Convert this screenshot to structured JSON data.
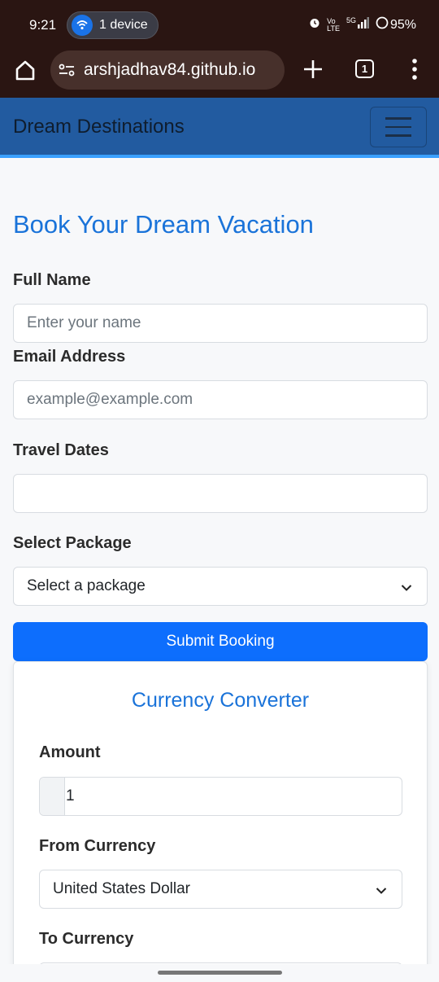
{
  "status_bar": {
    "time": "9:21",
    "device_pill": "1 device",
    "vo_top": "Vo",
    "vo_bottom": "LTE",
    "net": "5G",
    "battery": "95%"
  },
  "browser": {
    "url": "arshjadhav84.github.io",
    "tab_count": "1"
  },
  "navbar": {
    "brand": "Dream Destinations"
  },
  "booking_form": {
    "title": "Book Your Dream Vacation",
    "full_name_label": "Full Name",
    "full_name_placeholder": "Enter your name",
    "email_label": "Email Address",
    "email_placeholder": "example@example.com",
    "dates_label": "Travel Dates",
    "dates_value": "",
    "package_label": "Select Package",
    "package_selected": "Select a package",
    "submit_label": "Submit Booking"
  },
  "converter": {
    "title": "Currency Converter",
    "amount_label": "Amount",
    "amount_value": "1",
    "from_label": "From Currency",
    "from_selected": "United States Dollar",
    "to_label": "To Currency"
  },
  "colors": {
    "accent": "#1a73d9",
    "button": "#0d6efd",
    "navbar": "#225ba0"
  }
}
